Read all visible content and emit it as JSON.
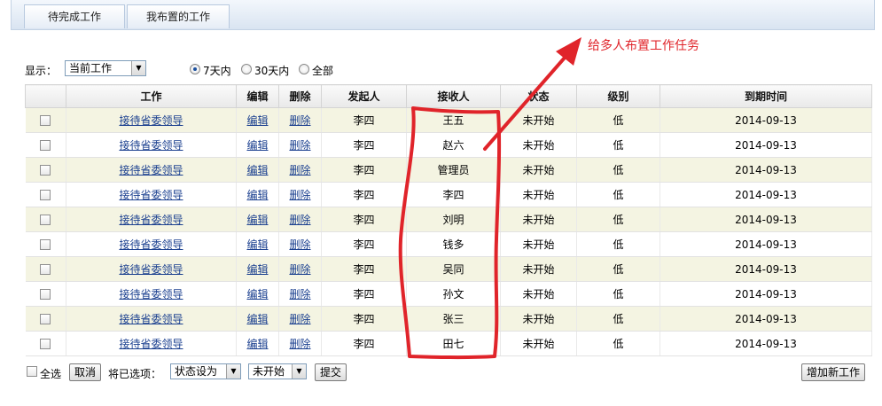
{
  "tabs": [
    {
      "label": "待完成工作"
    },
    {
      "label": "我布置的工作"
    }
  ],
  "filter": {
    "label": "显示：",
    "select_value": "当前工作",
    "range_options": [
      {
        "label": "7天内",
        "checked": true
      },
      {
        "label": "30天内",
        "checked": false
      },
      {
        "label": "全部",
        "checked": false
      }
    ]
  },
  "table": {
    "columns": [
      "工作",
      "编辑",
      "删除",
      "发起人",
      "接收人",
      "状态",
      "级别",
      "到期时间"
    ],
    "rows": [
      {
        "work": "接待省委领导",
        "edit": "编辑",
        "delete": "删除",
        "sender": "李四",
        "receiver": "王五",
        "status": "未开始",
        "level": "低",
        "due": "2014-09-13"
      },
      {
        "work": "接待省委领导",
        "edit": "编辑",
        "delete": "删除",
        "sender": "李四",
        "receiver": "赵六",
        "status": "未开始",
        "level": "低",
        "due": "2014-09-13"
      },
      {
        "work": "接待省委领导",
        "edit": "编辑",
        "delete": "删除",
        "sender": "李四",
        "receiver": "管理员",
        "status": "未开始",
        "level": "低",
        "due": "2014-09-13"
      },
      {
        "work": "接待省委领导",
        "edit": "编辑",
        "delete": "删除",
        "sender": "李四",
        "receiver": "李四",
        "status": "未开始",
        "level": "低",
        "due": "2014-09-13"
      },
      {
        "work": "接待省委领导",
        "edit": "编辑",
        "delete": "删除",
        "sender": "李四",
        "receiver": "刘明",
        "status": "未开始",
        "level": "低",
        "due": "2014-09-13"
      },
      {
        "work": "接待省委领导",
        "edit": "编辑",
        "delete": "删除",
        "sender": "李四",
        "receiver": "钱多",
        "status": "未开始",
        "level": "低",
        "due": "2014-09-13"
      },
      {
        "work": "接待省委领导",
        "edit": "编辑",
        "delete": "删除",
        "sender": "李四",
        "receiver": "吴同",
        "status": "未开始",
        "level": "低",
        "due": "2014-09-13"
      },
      {
        "work": "接待省委领导",
        "edit": "编辑",
        "delete": "删除",
        "sender": "李四",
        "receiver": "孙文",
        "status": "未开始",
        "level": "低",
        "due": "2014-09-13"
      },
      {
        "work": "接待省委领导",
        "edit": "编辑",
        "delete": "删除",
        "sender": "李四",
        "receiver": "张三",
        "status": "未开始",
        "level": "低",
        "due": "2014-09-13"
      },
      {
        "work": "接待省委领导",
        "edit": "编辑",
        "delete": "删除",
        "sender": "李四",
        "receiver": "田七",
        "status": "未开始",
        "level": "低",
        "due": "2014-09-13"
      }
    ]
  },
  "footer": {
    "select_all_label": "全选",
    "cancel_label": "取消",
    "apply_label": "将已选项：",
    "action_select": "状态设为",
    "status_select": "未开始",
    "submit_label": "提交",
    "add_label": "增加新工作"
  },
  "annotation": {
    "text": "给多人布置工作任务",
    "color": "#e0242a"
  }
}
